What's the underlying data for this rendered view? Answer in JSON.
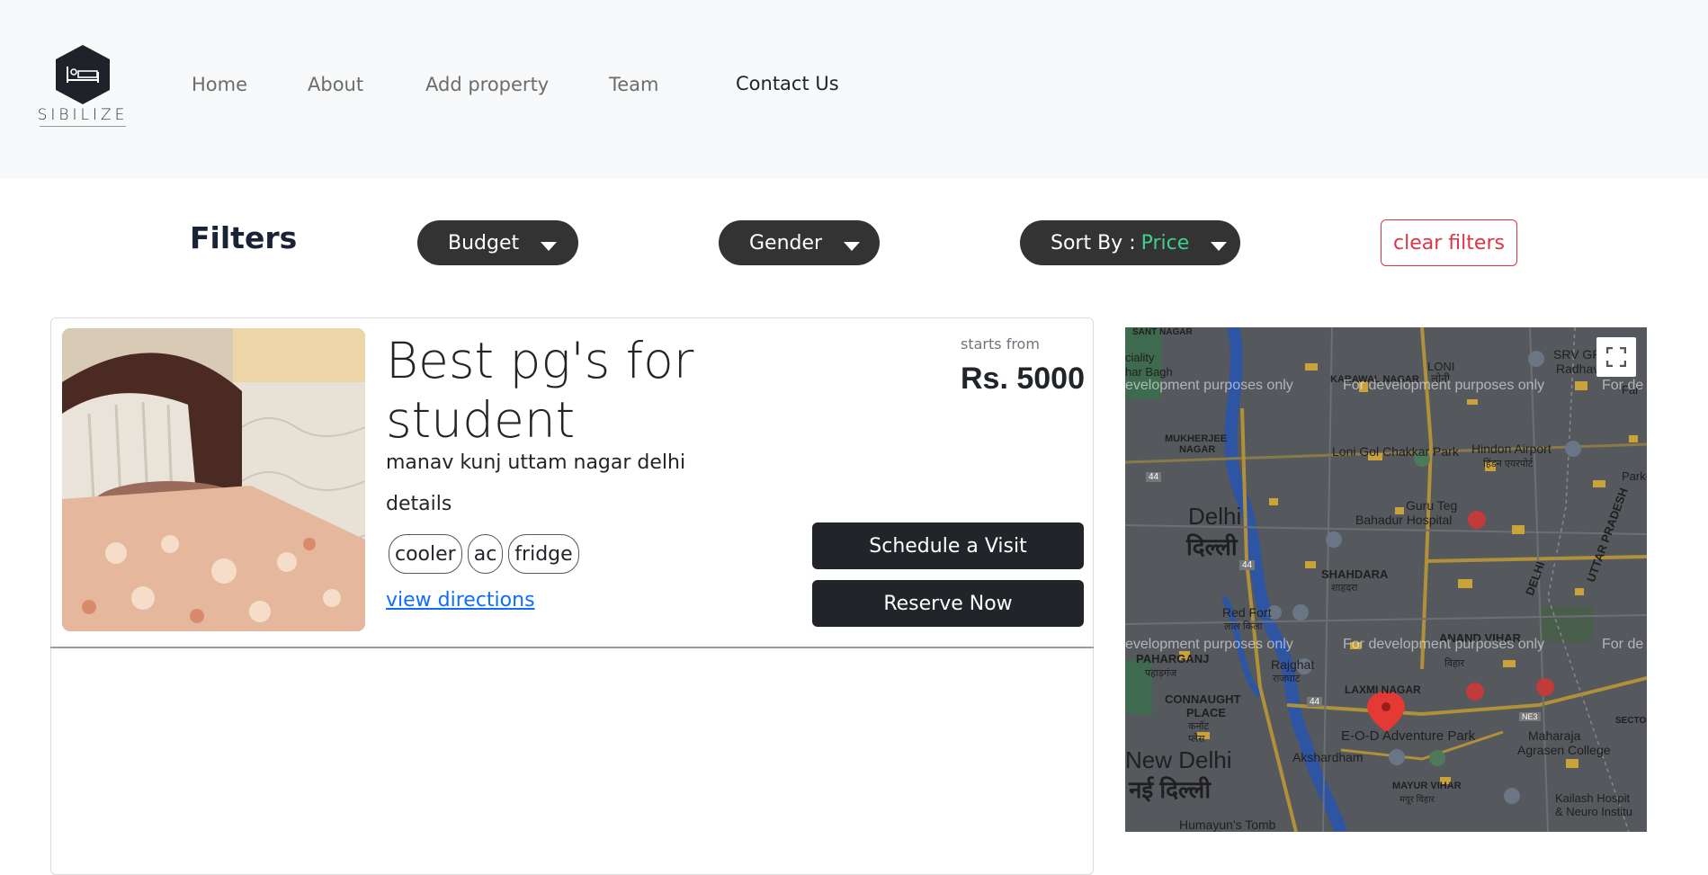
{
  "brand": {
    "name": "SIBILIZE"
  },
  "nav": [
    "Home",
    "About",
    "Add property",
    "Team",
    "Contact Us"
  ],
  "filters": {
    "title": "Filters",
    "budget": "Budget",
    "gender": "Gender",
    "sort_prefix": "Sort By :",
    "sort_value": "Price",
    "clear": "clear filters"
  },
  "listing": {
    "title": "Best pg's for student",
    "address": "manav kunj uttam nagar delhi",
    "details": "details",
    "amenities": [
      "cooler",
      "ac",
      "fridge"
    ],
    "directions_link": "view directions",
    "starts_from": "starts from",
    "price": "Rs. 5000",
    "schedule_button": "Schedule a Visit",
    "reserve_button": "Reserve Now"
  },
  "map": {
    "dev_watermark": "For development purposes only",
    "dev_watermark_cut_left": "evelopment purposes only",
    "dev_watermark_cut_right": "For de",
    "labels": {
      "delhi": "Delhi",
      "delhi_hi": "दिल्ली",
      "new_delhi": "New Delhi",
      "new_delhi_hi": "नई दिल्ली",
      "loni": "LONI",
      "loni_hi": "लोनी",
      "loni_gol": "Loni Gol Chakkar Park",
      "hindon": "Hindon Airport",
      "hindon_hi": "हिंडन एयरपोर्ट",
      "guru_teg": "Guru Teg",
      "bahadur": "Bahadur Hospital",
      "shahdara": "SHAHDARA",
      "shahdara_hi": "शाहदरा",
      "red_fort": "Red Fort",
      "red_fort_hi": "लाल किला",
      "anand_vihar": "ANAND VIHAR",
      "anand_vihar_hi": "विहार",
      "paharganj": "PAHARGANJ",
      "paharganj_hi": "पहाड़गंज",
      "rajghat": "Rajghat",
      "rajghat_hi": "राजघाट",
      "laxmi_nagar": "LAXMI NAGAR",
      "connaught": "CONNAUGHT",
      "place": "PLACE",
      "connaught_hi": "कनॉट",
      "connaught_hi2": "प्लेस",
      "eod": "E-O-D Adventure Park",
      "maharaja": "Maharaja",
      "agrasen": "Agrasen College",
      "akshardham": "Akshardham",
      "mayur_vihar": "MAYUR VIHAR",
      "mayur_vihar_hi": "मयूर विहार",
      "kailash": "Kailash Hospit",
      "neuro": "& Neuro Institu",
      "humayun": "Humayun's Tomb",
      "mukherjee": "MUKHERJEE",
      "nagar": "NAGAR",
      "karawal": "KARAWAL NAGAR",
      "srv": "SRV GR",
      "radhava": "Radhava",
      "sant_nagar": "SANT NAGAR",
      "ciality": "ciality",
      "har_bagh": "har Bagh",
      "park_g": "Park-G",
      "far": "Far",
      "uttar_pradesh": "UTTAR PRADESH",
      "delhi_state": "DELHI",
      "sector": "SECTO",
      "highway_44": "44",
      "ne3": "NE3"
    }
  }
}
